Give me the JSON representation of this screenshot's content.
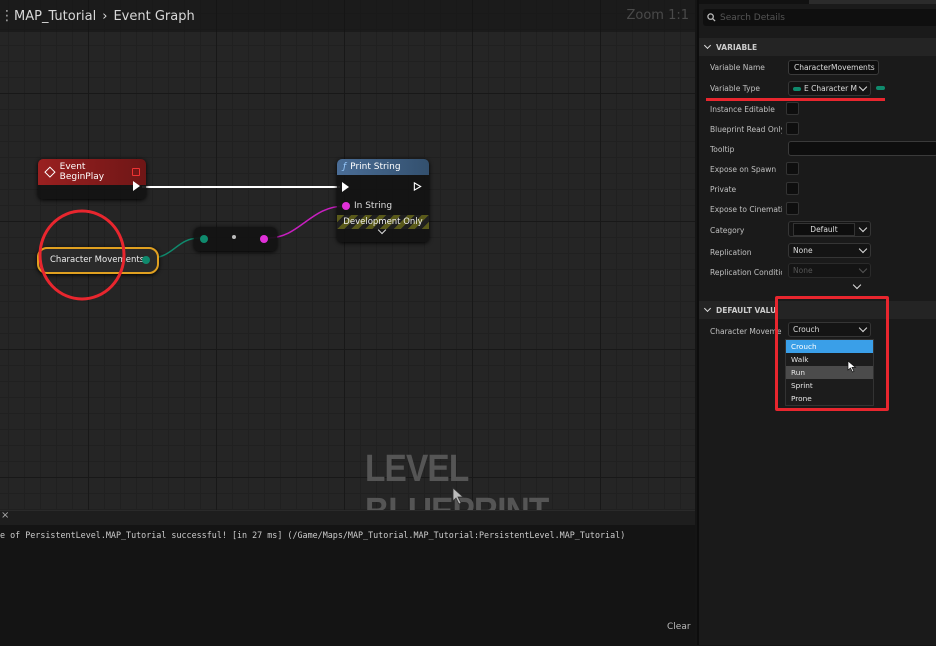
{
  "graph": {
    "breadcrumb": [
      "MAP_Tutorial",
      "Event Graph"
    ],
    "zoom": "Zoom 1:1",
    "watermark": "LEVEL BLUEPRINT",
    "nodes": {
      "event_begin_play": "Event BeginPlay",
      "print_string": "Print String",
      "print_in_string": "In String",
      "print_dev_only": "Development Only",
      "variable": "Character Movements"
    }
  },
  "console": {
    "log_line": "e of PersistentLevel.MAP_Tutorial successful! [in 27 ms] (/Game/Maps/MAP_Tutorial.MAP_Tutorial:PersistentLevel.MAP_Tutorial)",
    "clear_label": "Clear"
  },
  "details": {
    "search_placeholder": "Search Details",
    "variable_section": "VARIABLE",
    "variable_name_label": "Variable Name",
    "variable_name_value": "CharacterMovements",
    "variable_type_label": "Variable Type",
    "variable_type_value": "E Character M",
    "instance_editable": "Instance Editable",
    "blueprint_read_only": "Blueprint Read Only",
    "tooltip": "Tooltip",
    "expose_on_spawn": "Expose on Spawn",
    "private": "Private",
    "expose_cinematic": "Expose to Cinemati",
    "category_label": "Category",
    "category_value": "Default",
    "replication_label": "Replication",
    "replication_value": "None",
    "replication_condition_label": "Replication Conditic",
    "replication_condition_value": "None",
    "default_section": "DEFAULT VALU",
    "default_label": "Character Moveme",
    "default_value": "Crouch",
    "options": [
      "Crouch",
      "Walk",
      "Run",
      "Sprint",
      "Prone"
    ]
  },
  "colors": {
    "accent": "#3a9fe8",
    "event_header": "#8a1c1c",
    "function_header": "#3f5f84",
    "enum_pin": "#0f8a6d",
    "string_pin": "#e030d8",
    "annotation": "#e8262e"
  }
}
